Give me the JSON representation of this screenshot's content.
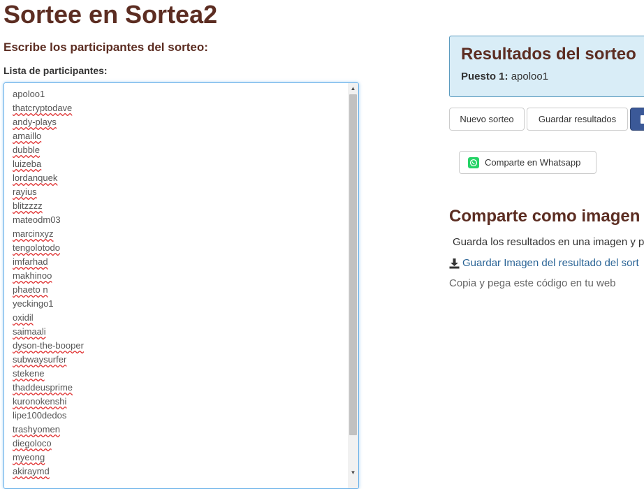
{
  "page_title": "Sortee en Sortea2",
  "subtitle": "Escribe los participantes del sorteo:",
  "list_label": "Lista de participantes:",
  "participants": [
    {
      "name": "apoloo1",
      "misspelled": false
    },
    {
      "name": "thatcryptodave",
      "misspelled": true
    },
    {
      "name": "andy-plays",
      "misspelled": true
    },
    {
      "name": "amaillo",
      "misspelled": true
    },
    {
      "name": "dubble",
      "misspelled": true
    },
    {
      "name": "luizeba",
      "misspelled": true
    },
    {
      "name": "lordanquek",
      "misspelled": true
    },
    {
      "name": "rayius",
      "misspelled": true
    },
    {
      "name": "blitzzzz",
      "misspelled": true
    },
    {
      "name": "mateodm03",
      "misspelled": false
    },
    {
      "name": "marcinxyz",
      "misspelled": true
    },
    {
      "name": "tengolotodo",
      "misspelled": true
    },
    {
      "name": "imfarhad",
      "misspelled": true
    },
    {
      "name": "makhinoo",
      "misspelled": true
    },
    {
      "name": "phaeto n",
      "misspelled": true
    },
    {
      "name": "yeckingo1",
      "misspelled": false
    },
    {
      "name": "oxidil",
      "misspelled": true
    },
    {
      "name": "saimaali",
      "misspelled": true
    },
    {
      "name": "dyson-the-booper",
      "misspelled": true
    },
    {
      "name": "subwaysurfer",
      "misspelled": true
    },
    {
      "name": "stekene",
      "misspelled": true
    },
    {
      "name": "thaddeusprime",
      "misspelled": true
    },
    {
      "name": "kuronokenshi",
      "misspelled": true
    },
    {
      "name": "lipe100dedos",
      "misspelled": false
    },
    {
      "name": "trashyomen",
      "misspelled": true
    },
    {
      "name": "diegoloco",
      "misspelled": true
    },
    {
      "name": "myeong",
      "misspelled": true
    },
    {
      "name": "akiraymd",
      "misspelled": true
    }
  ],
  "results": {
    "title": "Resultados del sorteo",
    "position_label": "Puesto 1:",
    "winner": "apoloo1"
  },
  "buttons": {
    "new_draw": "Nuevo sorteo",
    "save_results": "Guardar resultados",
    "whatsapp": "Comparte en Whatsapp"
  },
  "share": {
    "title": "Comparte como imagen",
    "description": "Guarda los resultados en una imagen y p",
    "save_image_link": "Guardar Imagen del resultado del sort",
    "embed_text": "Copia y pega este código en tu web"
  },
  "colors": {
    "heading": "#5c2d22",
    "results_bg": "#d9edf7",
    "link": "#2a6496",
    "whatsapp": "#25d366",
    "facebook": "#3b5998"
  },
  "icons": {
    "whatsapp": "whatsapp-icon",
    "download": "download-icon",
    "facebook": "facebook-icon"
  }
}
